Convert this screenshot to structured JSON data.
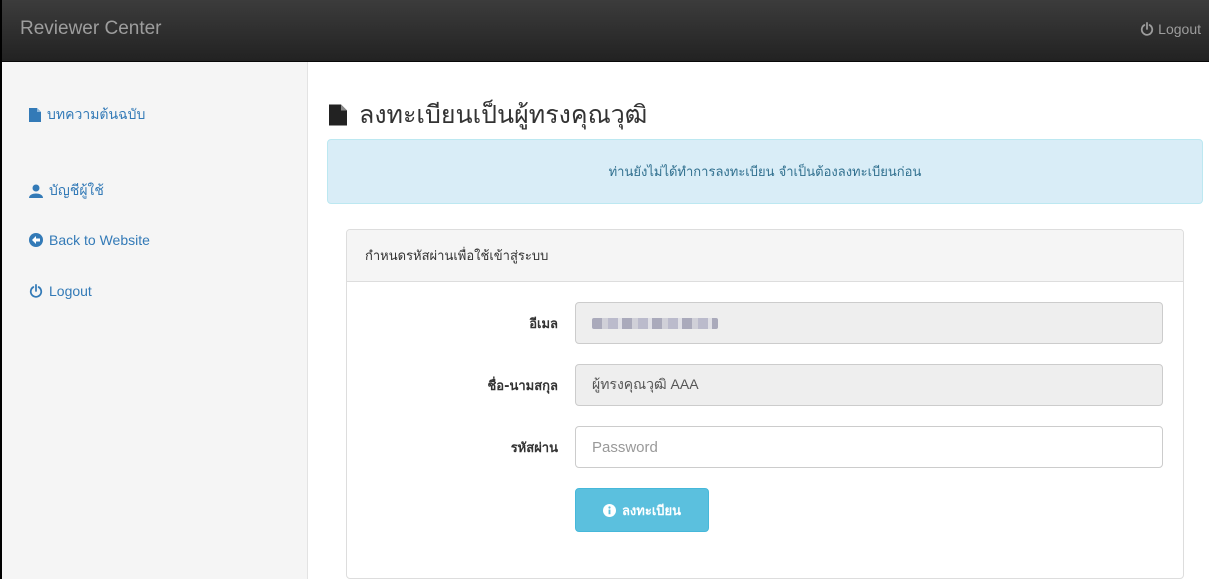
{
  "header": {
    "brand": "Reviewer Center",
    "logout_label": "Logout"
  },
  "sidebar": {
    "items": [
      {
        "label": "บทความต้นฉบับ",
        "icon": "file-icon"
      },
      {
        "label": "บัญชีผู้ใช้",
        "icon": "user-icon"
      },
      {
        "label": "Back to Website",
        "icon": "circle-arrow-left-icon"
      },
      {
        "label": "Logout",
        "icon": "power-icon"
      }
    ]
  },
  "main": {
    "title": "ลงทะเบียนเป็นผู้ทรงคุณวุฒิ",
    "alert": "ท่านยังไม่ได้ทำการลงทะเบียน จำเป็นต้องลงทะเบียนก่อน",
    "panel": {
      "heading": "กำหนดรหัสผ่านเพื่อใช้เข้าสู่ระบบ",
      "fields": {
        "email_label": "อีเมล",
        "name_label": "ชื่อ-นามสกุล",
        "name_value": "ผู้ทรงคุณวุฒิ AAA",
        "password_label": "รหัสผ่าน",
        "password_placeholder": "Password"
      },
      "submit_label": "ลงทะเบียน"
    }
  },
  "colors": {
    "navbar": "#222222",
    "link": "#337ab7",
    "alert_bg": "#d9edf7",
    "alert_text": "#31708f",
    "button_info": "#5bc0de"
  }
}
